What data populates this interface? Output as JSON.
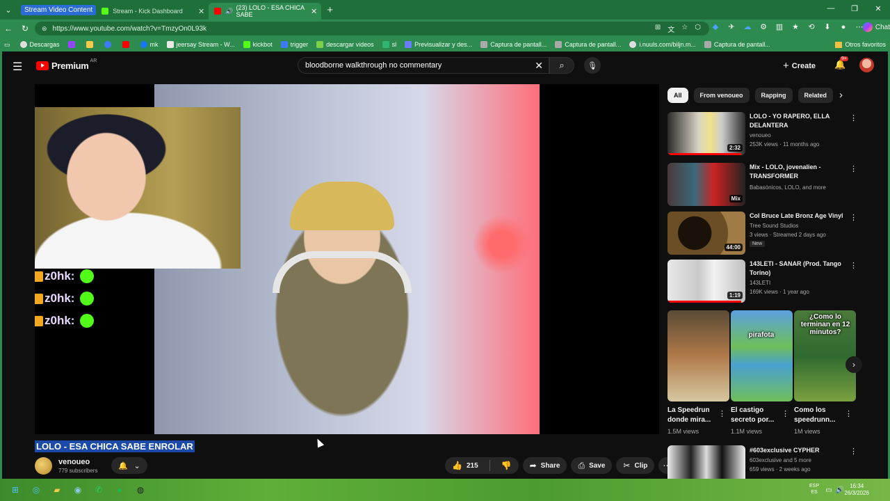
{
  "browser": {
    "tab_group_label": "Stream Video Content",
    "tabs": [
      {
        "title": "Stream - Kick Dashboard",
        "favicon_color": "#53fc18"
      },
      {
        "title": "(23) LOLO - ESA CHICA SABE",
        "favicon_color": "#ff0000",
        "active": true
      }
    ],
    "url": "https://www.youtube.com/watch?v=TmzyOn0L93k",
    "copilot_label": "Chat",
    "bookmarks": [
      "Descargas",
      "mk",
      "jeersay Stream - W...",
      "kickbot",
      "trigger",
      "descargar videos",
      "sl",
      "Previsualizar y des...",
      "Captura de pantall...",
      "Captura de pantall...",
      "i.nuuls.com/biljn.m...",
      "Captura de pantall..."
    ],
    "other_favorites": "Otros favoritos"
  },
  "youtube": {
    "logo": "Premium",
    "region": "AR",
    "search_query": "bloodborne walkthrough no commentary",
    "create_label": "Create",
    "notification_badge": "9+"
  },
  "video": {
    "title": "LOLO - ESA CHICA SABE ENROLAR",
    "channel": "venoueo",
    "subscribers": "779 subscribers",
    "likes": "215",
    "share_label": "Share",
    "save_label": "Save",
    "clip_label": "Clip",
    "chat_rows": [
      {
        "user": "z0hk:"
      },
      {
        "user": "z0hk:"
      },
      {
        "user": "z0hk:"
      }
    ]
  },
  "sidebar": {
    "chips": [
      "All",
      "From venoueo",
      "Rapping",
      "Related"
    ],
    "recommendations": [
      {
        "title": "LOLO - YO RAPERO, ELLA DELANTERA",
        "channel": "venoueo",
        "meta": "253K views · 11 months ago",
        "duration": "2:32",
        "progress": 0.95
      },
      {
        "title": "Mix - LOLO, jovenalien - TRANSFORMER",
        "channel": "Babasónicos, LOLO, and more",
        "meta": "",
        "duration": "Mix",
        "progress": 0
      },
      {
        "title": "Col Bruce Late  Bronz Age Vinyl",
        "channel": "Tree Sound Studios",
        "meta": "3 views · Streamed 2 days ago",
        "duration": "44:00",
        "badge": "New",
        "progress": 0
      },
      {
        "title": "143LETI - SANAR (Prod. Tango Torino)",
        "channel": "143LETI",
        "meta": "169K views · 1 year ago",
        "duration": "1:19",
        "progress": 0.95
      },
      {
        "title": "#603exclusive CYPHER",
        "channel": "603exclusive and 5 more",
        "meta": "659 views · 2 weeks ago",
        "duration": "",
        "progress": 0
      }
    ],
    "shorts": [
      {
        "title": "La Speedrun donde mira...",
        "views": "1.5M views",
        "overlay": ""
      },
      {
        "title": "El castigo secreto por...",
        "views": "1.1M views",
        "overlay": "pirafota"
      },
      {
        "title": "Como los speedrunn...",
        "views": "1M views",
        "overlay": "¿Como lo terminan en 12 minutos?"
      }
    ]
  },
  "taskbar": {
    "lang_top": "ESP",
    "lang_bottom": "ES",
    "time": "16:34",
    "date": "26/3/2026"
  }
}
